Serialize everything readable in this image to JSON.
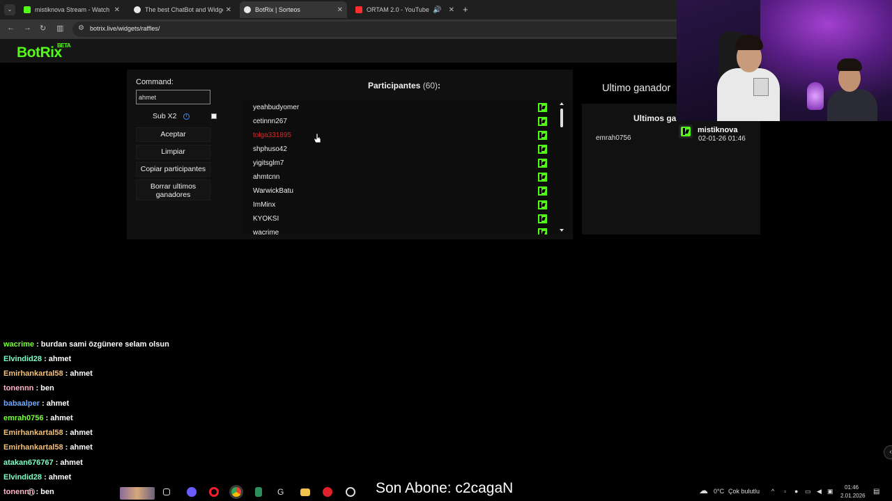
{
  "browser": {
    "tabs": [
      {
        "title": "mistiknova Stream - Watch Live",
        "favicon_color": "#53fc18",
        "active": false
      },
      {
        "title": "The best ChatBot and Widgets",
        "favicon_color": "#dddddd",
        "active": false
      },
      {
        "title": "BotRix | Sorteos",
        "favicon_color": "#dddddd",
        "active": true
      },
      {
        "title": "ORTAM 2.0 - YouTube",
        "favicon_color": "#ff2d2d",
        "active": false
      }
    ],
    "url": "botrix.live/widgets/raffles/"
  },
  "app": {
    "logo": "BotRix",
    "logo_badge": "BETA",
    "accent_color": "#53fc18"
  },
  "raffle": {
    "command_label": "Command:",
    "command_value": "ahmet",
    "sub_label": "Sub X2",
    "buttons": {
      "accept": "Aceptar",
      "clear": "Limpiar",
      "copy": "Copiar participantes",
      "delete_winners": "Borrar ultimos ganadores"
    },
    "participants_title": "Participantes",
    "participants_count": "(60)",
    "participants_colon": ":",
    "participants": [
      {
        "name": "yeahbudyomer",
        "highlight": false
      },
      {
        "name": "cetinnn267",
        "highlight": false
      },
      {
        "name": "tolga331895",
        "highlight": true
      },
      {
        "name": "shphuso42",
        "highlight": false
      },
      {
        "name": "yigitsglm7",
        "highlight": false
      },
      {
        "name": "ahmtcnn",
        "highlight": false
      },
      {
        "name": "WarwickBatu",
        "highlight": false
      },
      {
        "name": "ImMinx",
        "highlight": false
      },
      {
        "name": "KYOKSI",
        "highlight": false
      },
      {
        "name": "wacrime",
        "highlight": false
      }
    ],
    "winner_title": "Ultimo ganador",
    "last_winners_title": "Ultimos ga",
    "last_winners": [
      "emrah0756"
    ]
  },
  "overlay": {
    "user": "mistiknova",
    "date": "02-01-26 01:46"
  },
  "chat": [
    {
      "user": "wacrime",
      "color": "#7bff3a",
      "text": " : burdan sami özgünere selam olsun"
    },
    {
      "user": "Elvindid28",
      "color": "#7dffc6",
      "text": " : ahmet"
    },
    {
      "user": "Emirhankartal58",
      "color": "#f3c07a",
      "text": " : ahmet"
    },
    {
      "user": "tonennn",
      "color": "#ffb3c7",
      "text": " : ben"
    },
    {
      "user": "babaalper",
      "color": "#6fa8ff",
      "text": " : ahmet"
    },
    {
      "user": "emrah0756",
      "color": "#7bff3a",
      "text": " : ahmet"
    },
    {
      "user": "Emirhankartal58",
      "color": "#f3c07a",
      "text": " : ahmet"
    },
    {
      "user": "Emirhankartal58",
      "color": "#f3c07a",
      "text": " : ahmet"
    },
    {
      "user": "atakan676767",
      "color": "#7dffc6",
      "text": " : ahmet"
    },
    {
      "user": "Elvindid28",
      "color": "#7dffc6",
      "text": " : ahmet"
    },
    {
      "user": "tonennn",
      "color": "#ffb3c7",
      "text": " : ben"
    }
  ],
  "stream_overlay": {
    "last_subscriber": "Son Abone: c2cagaN"
  },
  "taskbar": {
    "weather_temp": "0°C",
    "weather_text": "Çok bulutlu",
    "time": "01:46",
    "date": "2.01.2026"
  }
}
